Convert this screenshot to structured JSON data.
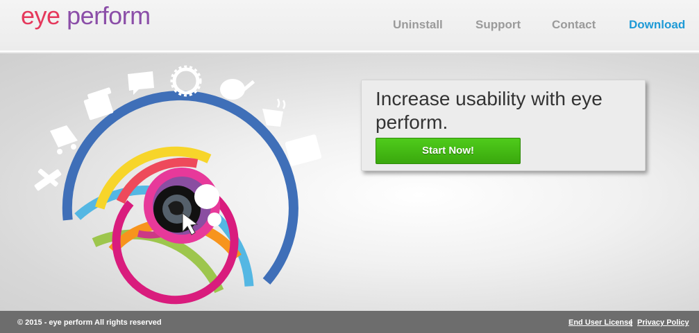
{
  "header": {
    "logo": {
      "word1": "eye",
      "word2": "perform"
    },
    "nav": [
      {
        "label": "Uninstall"
      },
      {
        "label": "Support"
      },
      {
        "label": "Contact"
      },
      {
        "label": "Download"
      }
    ]
  },
  "hero": {
    "headline": "Increase usability with eye perform.",
    "cta_label": "Start Now!",
    "icons": [
      "tools-icon",
      "shopping-cart-icon",
      "gift-icon",
      "chat-bubble-icon",
      "sun-icon",
      "paint-palette-icon",
      "coffee-cup-icon",
      "grid-window-icon"
    ],
    "ring_colors": [
      "#3f6fb8",
      "#54b7e3",
      "#9dc64d",
      "#f7d52a",
      "#f7941d",
      "#ee4a5b",
      "#d91c7d",
      "#8a4ea1"
    ]
  },
  "footer": {
    "copyright": "© 2015 - eye perform All rights reserved",
    "links": [
      {
        "label": "End User License"
      },
      {
        "label": "Privacy Policy"
      }
    ],
    "separator": "|"
  }
}
